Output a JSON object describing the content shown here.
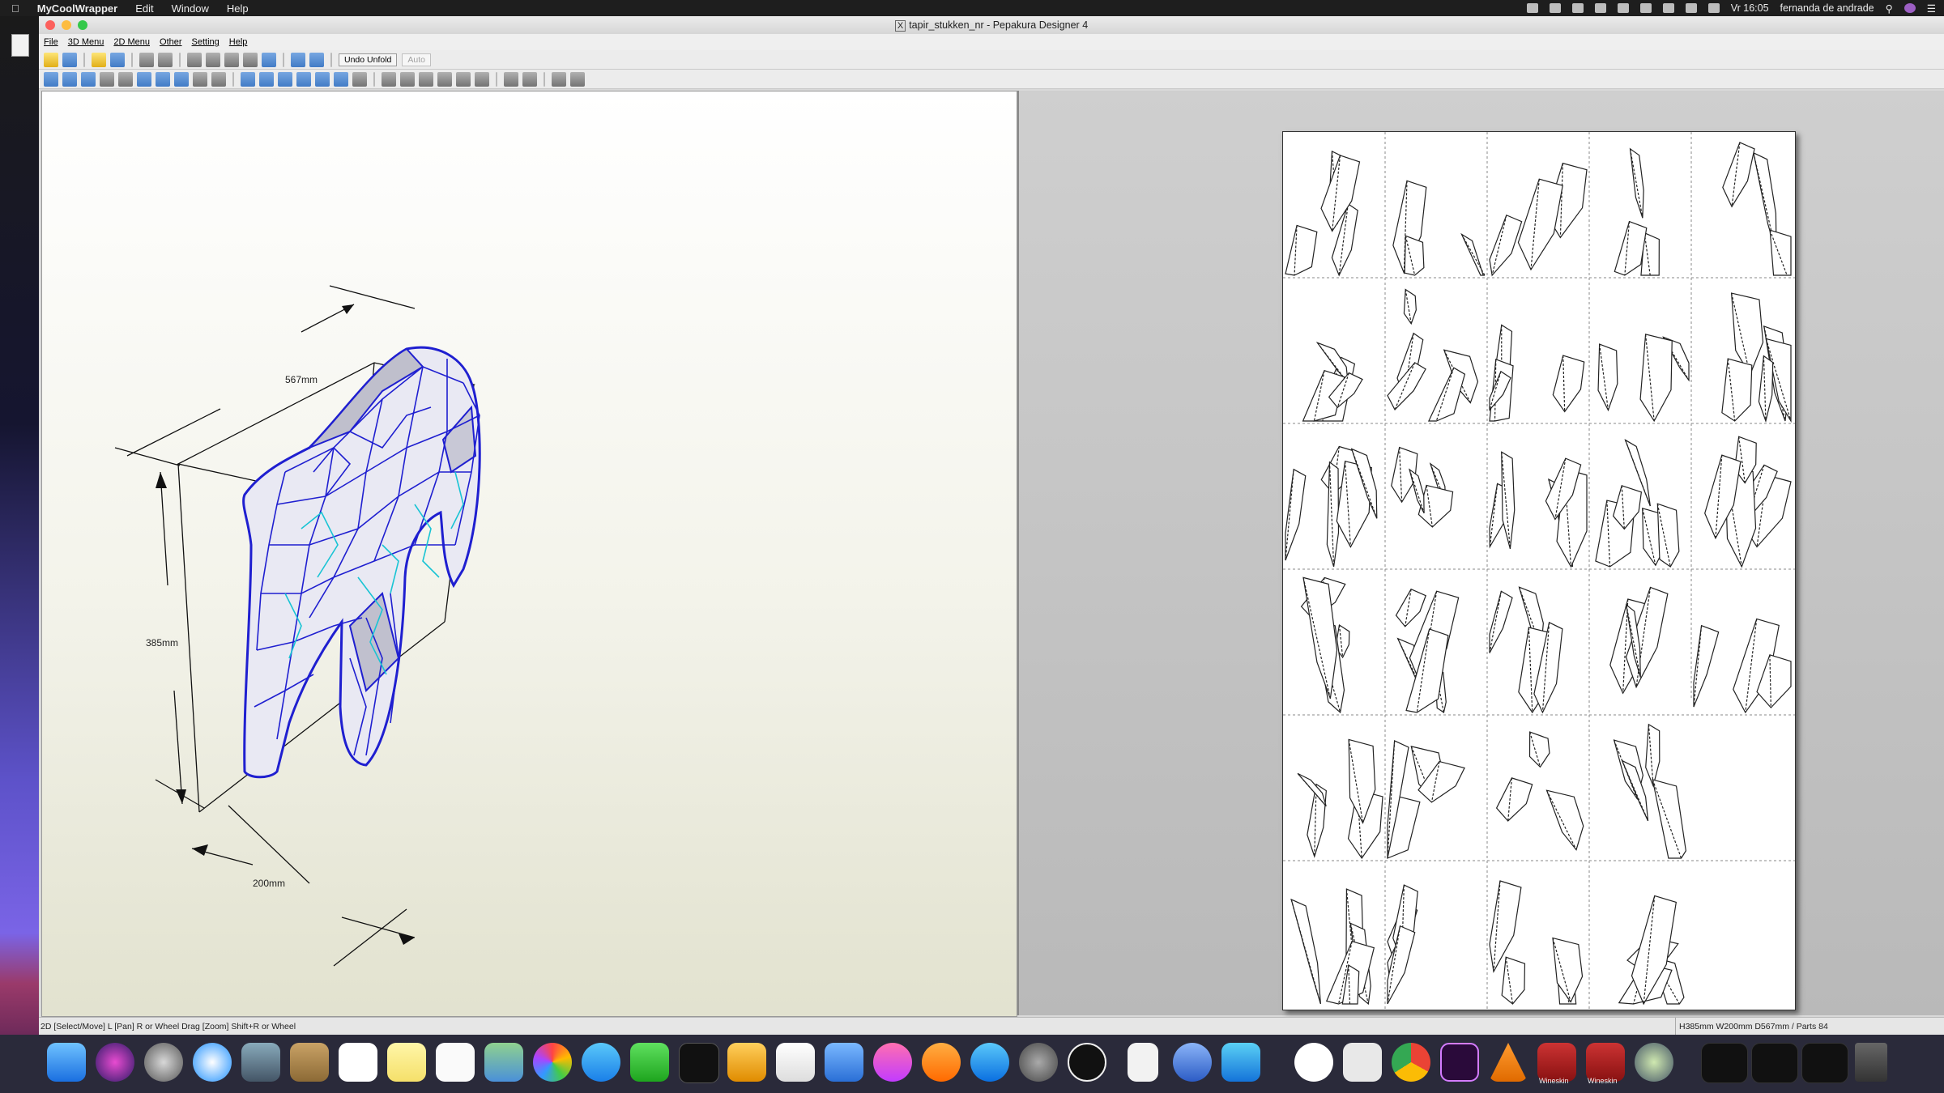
{
  "menubar": {
    "app": "MyCoolWrapper",
    "items": [
      "Edit",
      "Window",
      "Help"
    ],
    "clock": "Vr 16:05",
    "user": "fernanda de andrade"
  },
  "window": {
    "title": "tapir_stukken_nr - Pepakura Designer 4",
    "menu": [
      "File",
      "3D Menu",
      "2D Menu",
      "Other",
      "Setting",
      "Help"
    ],
    "toolbar": {
      "undo_unfold": "Undo Unfold",
      "auto": "Auto"
    }
  },
  "view3d": {
    "dim_length": "567mm",
    "dim_height": "385mm",
    "dim_width": "200mm"
  },
  "status": {
    "left": "2D [Select/Move] L [Pan] R or Wheel Drag [Zoom] Shift+R or Wheel",
    "right": "H385mm W200mm D567mm / Parts 84"
  },
  "dock": {
    "wineskin1": "Wineskin",
    "wineskin2": "Wineskin"
  },
  "colors": {
    "mesh": "#2323d6",
    "fold": "#19c4d4",
    "paper": "#ffffff",
    "accent": "#007aff"
  }
}
